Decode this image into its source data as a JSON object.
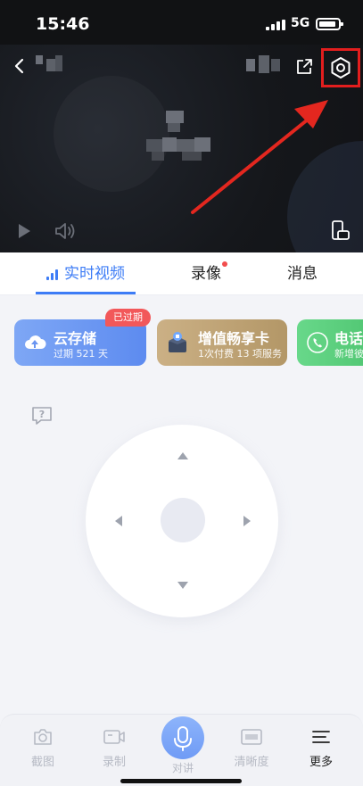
{
  "status_bar": {
    "time": "15:46",
    "network": "5G"
  },
  "video": {
    "icons": [
      "chevron-left-icon",
      "share-icon",
      "settings-icon",
      "play-icon",
      "volume-icon",
      "rotate-screen-icon"
    ]
  },
  "tabs": [
    {
      "label": "实时视频",
      "active": true
    },
    {
      "label": "录像",
      "has_dot": true
    },
    {
      "label": "消息"
    }
  ],
  "services": [
    {
      "title": "云存储",
      "subtitle": "过期 521 天",
      "badge": "已过期",
      "icon": "cloud-upload-icon"
    },
    {
      "title": "增值畅享卡",
      "subtitle": "1次付费 13 项服务",
      "icon": "gift-box-icon"
    },
    {
      "title": "电话",
      "subtitle": "新增彼",
      "icon": "phone-icon"
    }
  ],
  "ptz": {
    "icons": [
      "arrow-up-icon",
      "arrow-down-icon",
      "arrow-left-icon",
      "arrow-right-icon"
    ]
  },
  "actions": {
    "screenshot": "截图",
    "record": "录制",
    "talk": "对讲",
    "hd": "清晰度",
    "more": "更多"
  },
  "colors": {
    "accent": "#3d7cf6",
    "highlight": "#e31e1e",
    "badge": "#f2585a"
  }
}
